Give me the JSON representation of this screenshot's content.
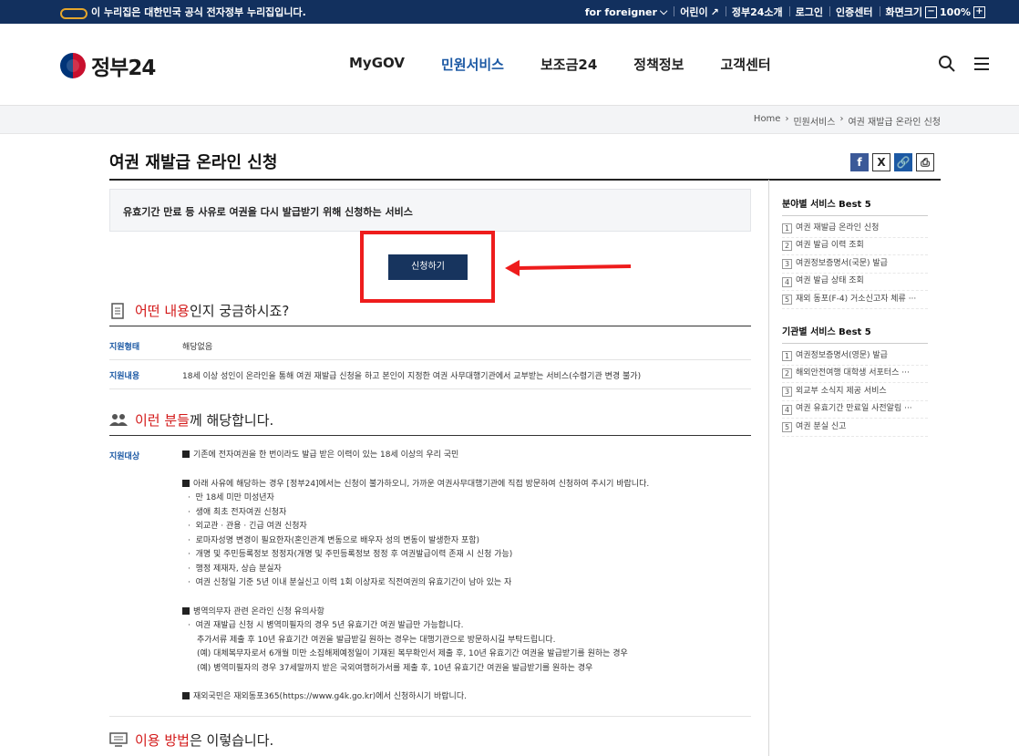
{
  "gov_banner": {
    "notice": "이 누리집은 대한민국 공식 전자정부 누리집입니다.",
    "links": [
      "for foreigner",
      "어린이",
      "정부24소개",
      "로그인",
      "인증센터",
      "화면크기"
    ],
    "zoom": "100%",
    "zoom_minus": "−",
    "zoom_plus": "+"
  },
  "header": {
    "logo": "정부24",
    "nav": [
      "MyGOV",
      "민원서비스",
      "보조금24",
      "정책정보",
      "고객센터"
    ]
  },
  "breadcrumb": [
    "Home",
    "민원서비스",
    "여권 재발급 온라인 신청"
  ],
  "page": {
    "title": "여권 재발급 온라인 신청",
    "summary": "유효기간 만료 등 사유로 여권을 다시 발급받기 위해 신청하는 서비스",
    "apply_label": "신청하기"
  },
  "share": {
    "facebook": "f",
    "x": "X",
    "link": "🔗",
    "print": "⎙"
  },
  "section1": {
    "title_red": "어떤 내용",
    "title_rest": "인지 궁금하시죠?",
    "rows": [
      {
        "label": "지원형태",
        "value": "해당없음"
      },
      {
        "label": "지원내용",
        "value": "18세 이상 성인이 온라인을 통해 여권 재발급 신청을 하고 본인이 지정한 여권 사무대행기관에서 교부받는 서비스(수령기관 변경 불가)"
      }
    ]
  },
  "section2": {
    "title_red": "이런 분들",
    "title_rest": "께 해당합니다.",
    "label": "지원대상",
    "block1": "기존에 전자여권을 한 번이라도 발급 받은 이력이 있는 18세 이상의 우리 국민",
    "block2_head": "아래 사유에 해당하는 경우 [정부24]에서는 신청이 불가하오니, 가까운 여권사무대행기관에 직접 방문하여 신청하여 주시기 바랍니다.",
    "block2_items": [
      "만 18세 미만 미성년자",
      "생애 최초 전자여권 신청자",
      "외교관 · 관용 · 긴급 여권 신청자",
      "로마자성명 변경이 필요한자(혼인관계 변동으로 배우자 성의 변동이 발생한자 포함)",
      "개명 및 주민등록정보 정정자(개명 및 주민등록정보 정정 후 여권발급이력 존재 시 신청 가능)",
      "행정 제재자, 상습 분실자",
      "여권 신청일 기준 5년 이내 분실신고 이력 1회 이상자로 직전여권의 유효기간이 남아 있는 자"
    ],
    "block3_head": "병역의무자 관련 온라인 신청 유의사항",
    "block3_item": "여권 재발급 신청 시 병역미필자의 경우 5년 유효기간 여권 발급만 가능합니다.",
    "block3_sub": [
      "추가서류 제출 후 10년 유효기간 여권을 발급받길 원하는 경우는 대행기관으로 방문하시길 부탁드립니다.",
      "(예) 대체복무자로서 6개월 미만 소집해제예정일이 기재된 복무확인서 제출 후, 10년 유효기간 여권을 발급받기를 원하는 경우",
      "(예) 병역미필자의 경우 37세말까지 받은 국외여행허가서를 제출 후, 10년 유효기간 여권을 발급받기를 원하는 경우"
    ],
    "block4": "재외국민은 재외동포365(https://www.g4k.go.kr)에서 신청하시기 바랍니다."
  },
  "section3": {
    "title_red": "이용 방법",
    "title_rest": "은 이렇습니다."
  },
  "side": {
    "best_field_title": "분야별 서비스 Best 5",
    "best_field": [
      "여권 재발급 온라인 신청",
      "여권 발급 이력 조회",
      "여권정보증명서(국문) 발급",
      "여권 발급 상태 조회",
      "재외 동포(F-4) 거소신고자 체류 ···"
    ],
    "best_org_title": "기관별 서비스 Best 5",
    "best_org": [
      "여권정보증명서(영문) 발급",
      "해외안전여행 대학생 서포터스 ···",
      "외교부 소식지 제공 서비스",
      "여권 유효기간 만료일 사전알림 ···",
      "여권 분실 신고"
    ]
  }
}
